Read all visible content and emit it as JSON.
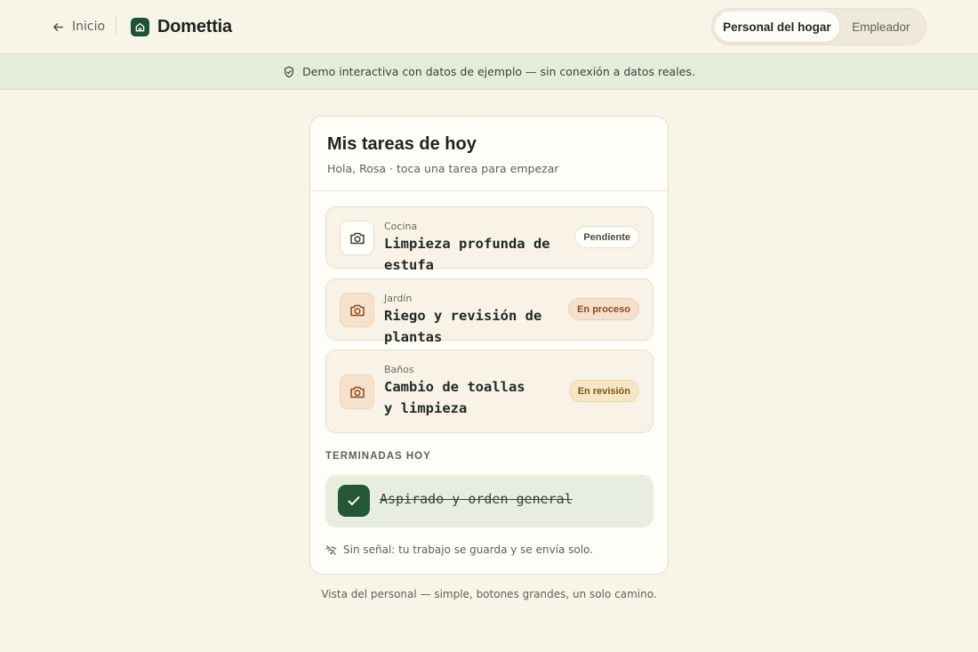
{
  "header": {
    "back_label": "Inicio",
    "brand_name": "Domettia",
    "roles": [
      {
        "label": "Personal del hogar",
        "active": true
      },
      {
        "label": "Empleador",
        "active": false
      }
    ]
  },
  "banner": {
    "text": "Demo interactiva con datos de ejemplo — sin conexión a datos reales."
  },
  "card": {
    "title": "Mis tareas de hoy",
    "subtitle": "Hola, Rosa · toca una tarea para empezar",
    "tasks": [
      {
        "area": "Cocina",
        "name": "Limpieza profunda de estufa",
        "status": "Pendiente",
        "icon": "camera-icon"
      },
      {
        "area": "Jardín",
        "name": "Riego y revisión de plantas",
        "status": "En proceso",
        "icon": "camera-icon"
      },
      {
        "area": "Baños",
        "name": "Cambio de toallas y limpieza",
        "status": "En revisión",
        "icon": "camera-icon"
      }
    ],
    "done_label": "TERMINADAS HOY",
    "done_items": [
      {
        "name": "Aspirado y orden general"
      }
    ],
    "offline_note": "Sin señal: tu trabajo se guarda y se envía solo."
  },
  "footer": {
    "text": "Vista del personal — simple, botones grandes, un solo camino."
  },
  "colors": {
    "background": "#f9f4e8",
    "brand": "#1e5236",
    "banner": "#e6ecdc",
    "badge_in_progress": "#f6e0cc",
    "badge_review": "#f6e6c4"
  }
}
